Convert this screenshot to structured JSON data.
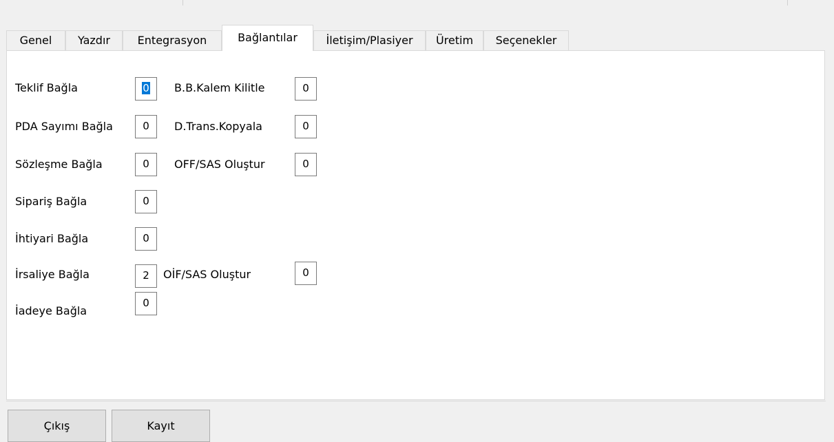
{
  "tabs": [
    "Genel",
    "Yazdır",
    "Entegrasyon",
    "Bağlantılar",
    "İletişim/Plasiyer",
    "Üretim",
    "Seçenekler"
  ],
  "active_tab": "Bağlantılar",
  "fields": {
    "teklif": {
      "label": "Teklif Bağla",
      "value": "0"
    },
    "pda": {
      "label": "PDA Sayımı Bağla",
      "value": "0"
    },
    "sozlesme": {
      "label": "Sözleşme Bağla",
      "value": "0"
    },
    "siparis": {
      "label": "Sipariş Bağla",
      "value": "0"
    },
    "ihtiyari": {
      "label": "İhtiyari Bağla",
      "value": "0"
    },
    "irsaliye": {
      "label": "İrsaliye Bağla",
      "value": "2"
    },
    "iadeye": {
      "label": "İadeye Bağla",
      "value": "0"
    },
    "bb_kalem": {
      "label": "B.B.Kalem Kilitle",
      "value": "0"
    },
    "dtrans": {
      "label": "D.Trans.Kopyala",
      "value": "0"
    },
    "off_sas": {
      "label": "OFF/SAS Oluştur",
      "value": "0"
    },
    "oif_sas": {
      "label": "OİF/SAS Oluştur",
      "value": "0"
    }
  },
  "buttons": {
    "exit": "Çıkış",
    "save": "Kayıt"
  }
}
